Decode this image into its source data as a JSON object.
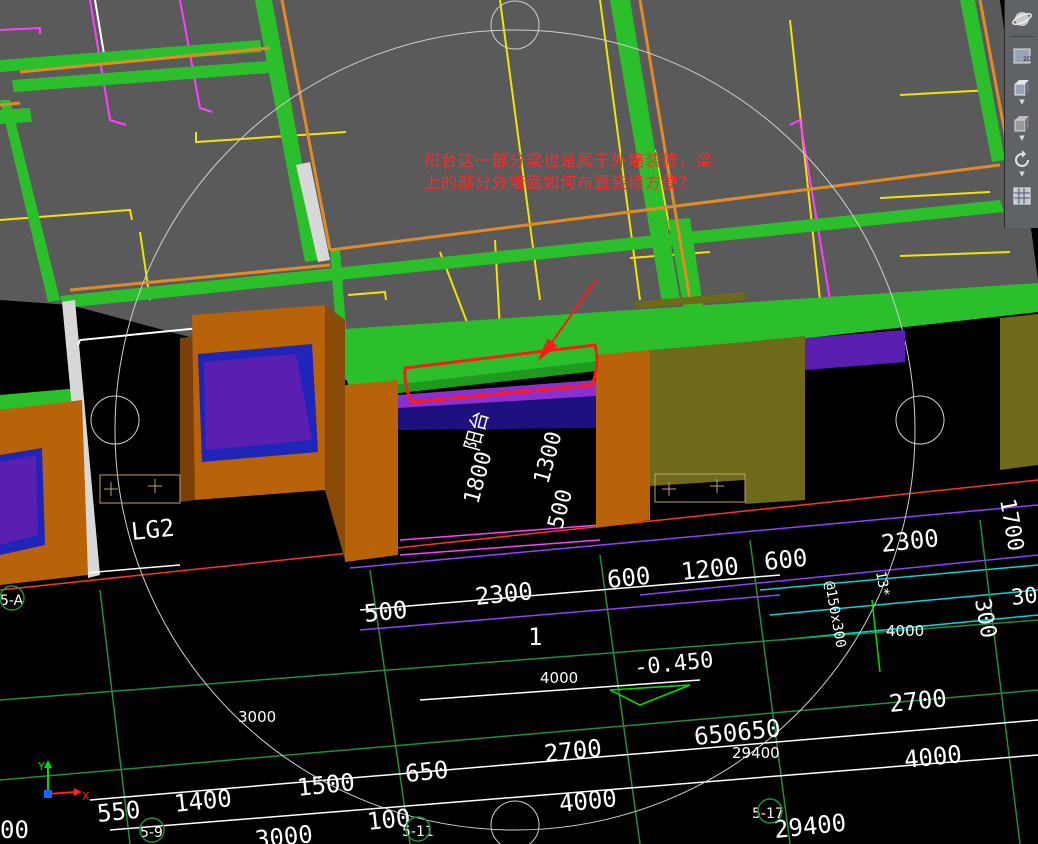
{
  "annotation": {
    "line1": "阳台这一部分梁也是属于外墙装修，梁",
    "line2": "上的部分外墙面如何布置装修方便？"
  },
  "room_labels": {
    "balcony": "阳台",
    "lg2": "LG2",
    "elev": "-0.450",
    "tag": "13*",
    "beam": "@150x300"
  },
  "dims": {
    "d1800": "1800",
    "d1300": "1300",
    "d500a": "500",
    "d500b": "500",
    "d2300a": "2300",
    "d600a": "600",
    "d1200": "1200",
    "d600b": "600",
    "d2300b": "2300",
    "d1700": "1700",
    "d300": "300",
    "d30": "30",
    "d1": "1",
    "d4000a": "4000",
    "d4000b": "4000",
    "d3000": "3000",
    "d2700a": "2700",
    "d650650": "650650",
    "d29400a": "29400",
    "d2700b": "2700",
    "d4000c": "4000",
    "d550": "550",
    "d1400": "1400",
    "d1500": "1500",
    "d650": "650",
    "d4000d": "4000",
    "d100": "100",
    "d29400b": "29400",
    "d00": "00",
    "d3000b": "3000"
  },
  "axis_labels": {
    "a5A": "5-A",
    "a59": "5-9",
    "a511": "5-11",
    "a517": "5-17"
  },
  "ucs": {
    "x": "X",
    "y": "Y"
  },
  "toolbar": {
    "items": [
      "navigation-wheel-icon",
      "2d-view-icon",
      "3d-view-icon",
      "cube-view-icon",
      "orbit-icon",
      "grid-display-icon"
    ]
  },
  "colors": {
    "background": "#000000",
    "slab": "#5a5a5a",
    "beam_green": "#2cbf2c",
    "beam_orange": "#e08b28",
    "column": "#b8620a",
    "window": "#5a1fb0",
    "annotation": "#ff2a2a",
    "dim_white": "#ffffff",
    "grid_green": "#1e8f3a"
  }
}
